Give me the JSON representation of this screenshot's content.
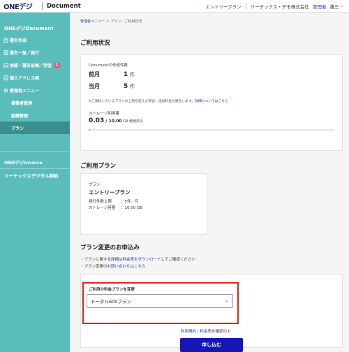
{
  "header": {
    "logo_text": "ONEデジ",
    "app_title": "Document",
    "plan_link": "エントリープラン",
    "company": "リーテックス・デモ株式会社",
    "admin_link": "管理者",
    "user_name": "蓮三"
  },
  "sidebar": {
    "brand": "ONEデジDocument",
    "items": [
      {
        "label": "署名作成",
        "icon": "document-edit-icon"
      },
      {
        "label": "署名一覧／発行",
        "icon": "list-icon"
      },
      {
        "label": "承認・署名依頼／受信",
        "icon": "inbox-icon",
        "badge": "1"
      },
      {
        "label": "個人アドレス帳",
        "icon": "address-book-icon"
      },
      {
        "label": "管理者メニュー",
        "icon": "gear-icon"
      }
    ],
    "sub_items": [
      {
        "label": "事業者管理"
      },
      {
        "label": "組織管理"
      },
      {
        "label": "プラン"
      }
    ],
    "section1": "ONEデジInvoice",
    "section2": "リーテックスデジタル契約"
  },
  "breadcrumb": {
    "link": "管理者メニュー",
    "sep1": " ＞ ",
    "current": "プラン／ご利用状況"
  },
  "usage": {
    "heading": "ご利用状況",
    "doc_count_label": "Documentの作成件数",
    "prev_month_label": "前月",
    "prev_month_value": "1",
    "this_month_label": "当月",
    "this_month_value": "5",
    "unit": "件",
    "note": "※ご契約しているプランの上限を超えた場合、追加料金が発生します。",
    "note_link": "詳細についてはこちら",
    "storage_label": "ストレージ利用量",
    "storage_used": "0.03",
    "storage_total": " / 10.00",
    "storage_unit": " GB 使用済み",
    "storage_fraction": 0.003
  },
  "plan": {
    "heading": "ご利用プラン",
    "plan_label": "プラン",
    "plan_name": "エントリープラン",
    "limit_label": "発行件数上限",
    "limit_value": "：5件／月",
    "storage_label": "ストレージ容量",
    "storage_value": "：10.00 GB"
  },
  "change": {
    "heading": "プラン変更のお申込み",
    "line1_prefix": "・プランに関する詳細は",
    "line1_link": "料金表をダウンロード",
    "line1_suffix": "してご確認ください",
    "line2_prefix": "・プラン変更の",
    "line2_link": "お問い合わせはこちら",
    "select_label": "ご利用の料金プランを変更",
    "select_value": "トータル600プラン",
    "terms_link1": "利用規約",
    "terms_dot": "・",
    "terms_link2": "料金表",
    "terms_suffix": "を確認の上",
    "submit_label": "申し込む"
  },
  "colors": {
    "sidebar": "#5bbdbb",
    "sidebar_active": "#3a8f8d",
    "link": "#1a3f9e",
    "submit": "#1515b8",
    "highlight": "#e0231d"
  }
}
